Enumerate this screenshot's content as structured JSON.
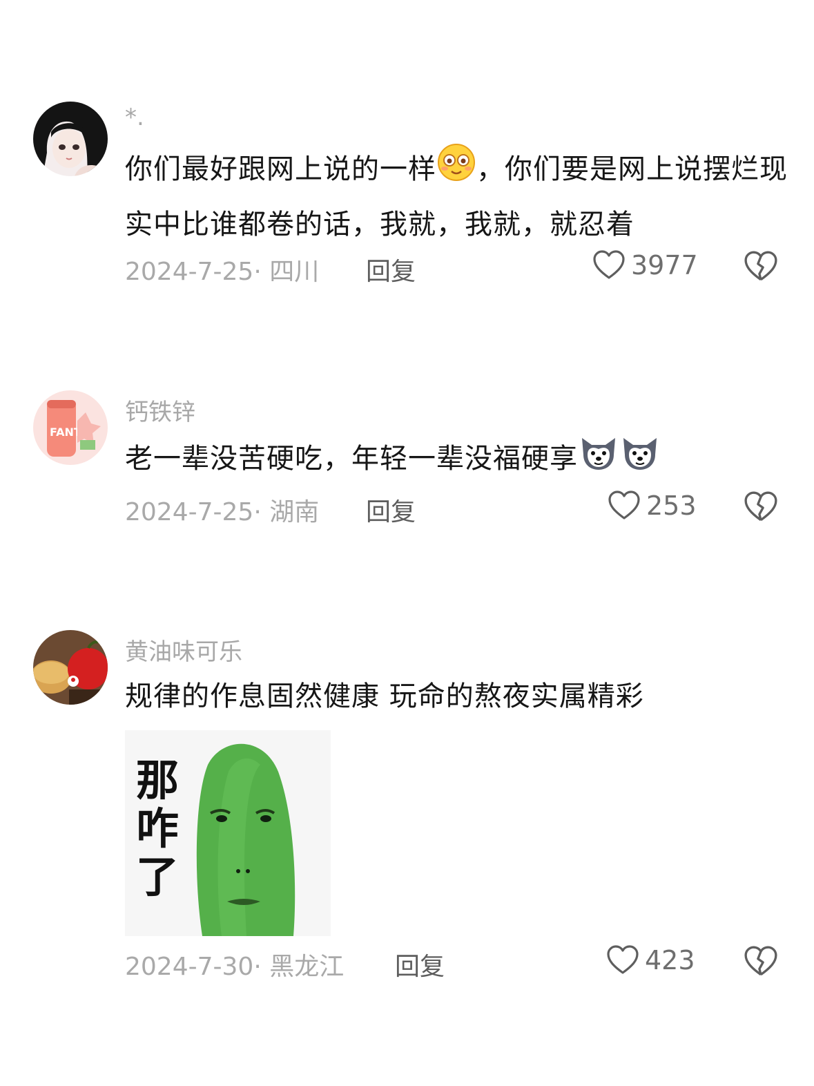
{
  "comments": [
    {
      "username": "*.",
      "text_a": "你们最好跟网上说的一样",
      "text_b": "，你们要是网上说摆烂现实中比谁都卷的话，我就，我就，就忍着",
      "date": "2024-7-25",
      "location": "四川",
      "reply_label": "回复",
      "likes": "3977"
    },
    {
      "username": "钙铁锌",
      "text_a": "老一辈没苦硬吃，年轻一辈没福硬享",
      "date": "2024-7-25",
      "location": "湖南",
      "reply_label": "回复",
      "likes": "253"
    },
    {
      "username": "黄油味可乐",
      "text_a": "规律的作息固然健康 玩命的熬夜实属精彩",
      "sticker_text": "那咋了",
      "date": "2024-7-30",
      "location": "黑龙江",
      "reply_label": "回复",
      "likes": "423"
    }
  ],
  "icons": {
    "like": "heart-outline-icon",
    "dislike": "broken-heart-icon"
  },
  "colors": {
    "text": "#161616",
    "meta": "#a9a9a9",
    "reply": "#5d5d5d"
  }
}
